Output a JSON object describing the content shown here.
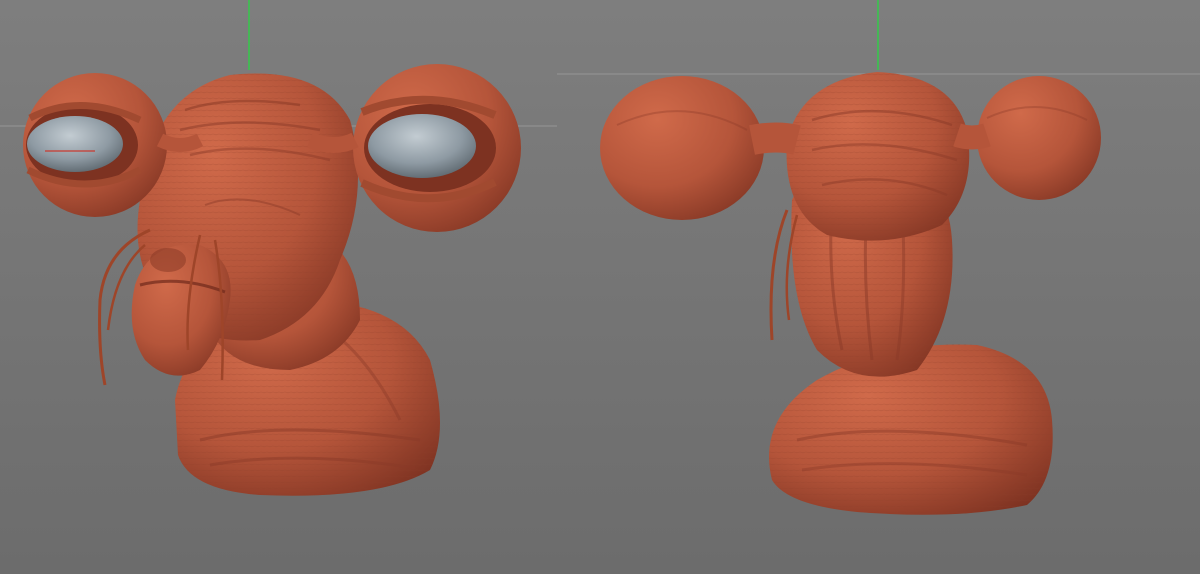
{
  "scene": {
    "background_color": "#787878",
    "clay_color": "#B8573C",
    "eye_color": "#8E9AA3",
    "axis_y_color": "#35C94A",
    "axis_x_color": "#C9392F",
    "horizon_color": "#A9A9A9"
  },
  "views": [
    {
      "view": "front-three-quarter"
    },
    {
      "view": "back-three-quarter"
    }
  ]
}
